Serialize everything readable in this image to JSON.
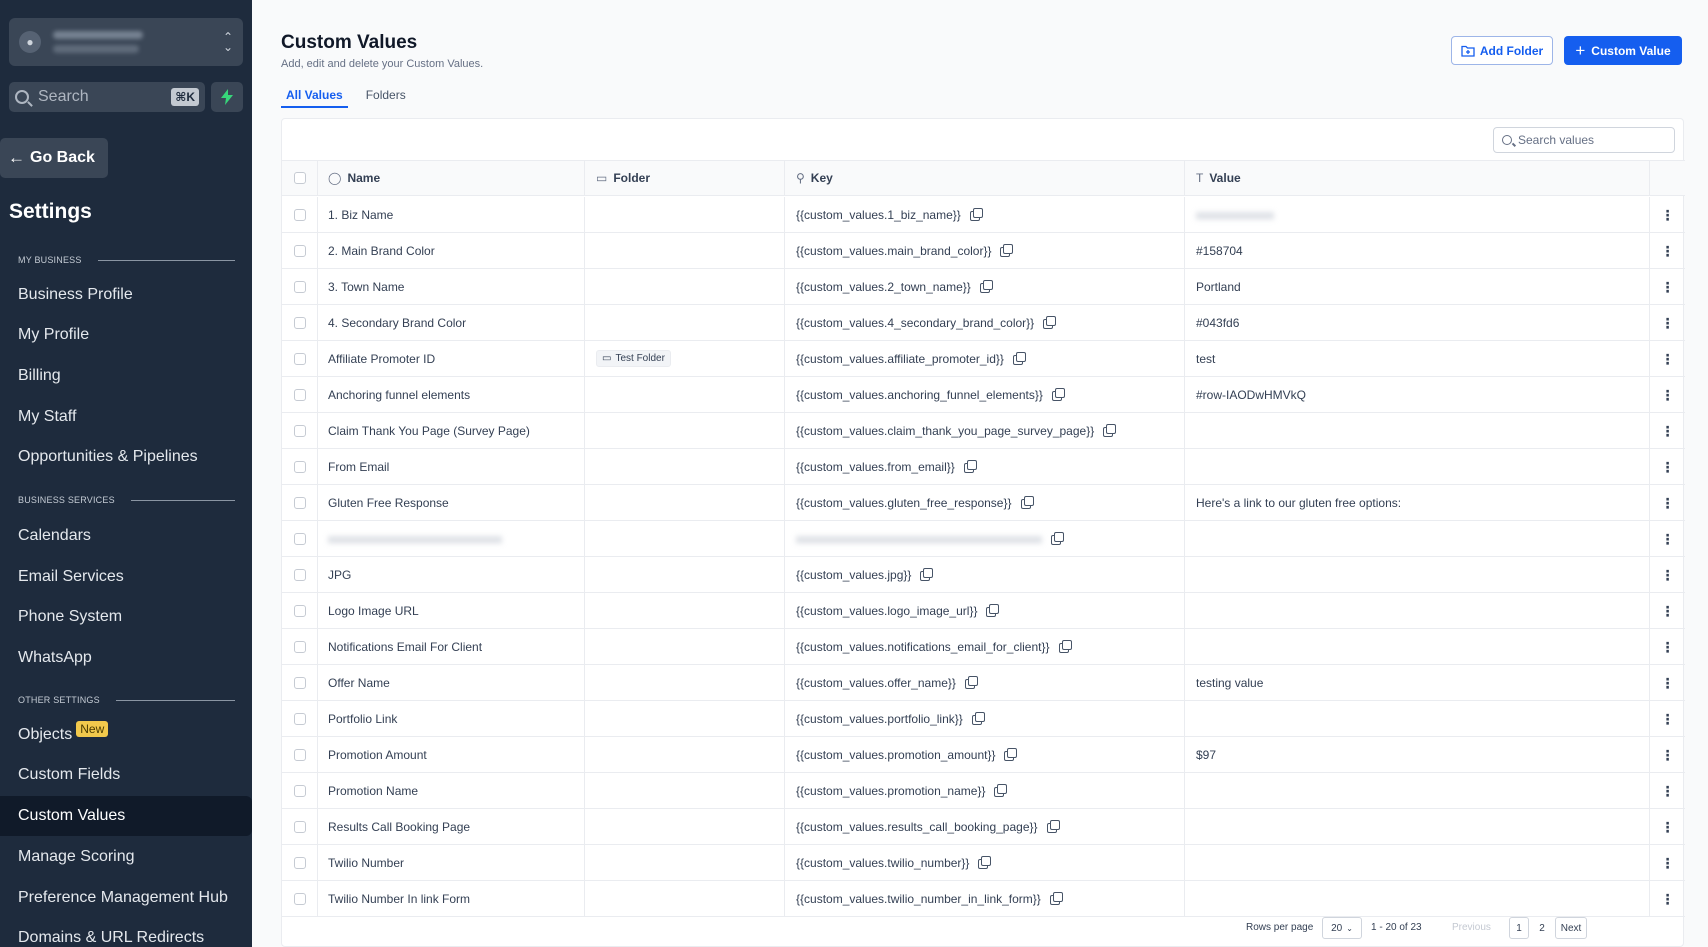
{
  "sidebar": {
    "search_placeholder": "Search",
    "shortcut": "⌘K",
    "go_back": "Go Back",
    "settings_title": "Settings",
    "sections": [
      {
        "label": "MY BUSINESS",
        "items": [
          "Business Profile",
          "My Profile",
          "Billing",
          "My Staff",
          "Opportunities & Pipelines"
        ]
      },
      {
        "label": "BUSINESS SERVICES",
        "items": [
          "Calendars",
          "Email Services",
          "Phone System",
          "WhatsApp"
        ]
      },
      {
        "label": "OTHER SETTINGS",
        "items": [
          "Objects",
          "Custom Fields",
          "Custom Values",
          "Manage Scoring",
          "Preference Management Hub",
          "Domains & URL Redirects"
        ]
      }
    ],
    "new_badge": "New",
    "active_item": "Custom Values"
  },
  "header": {
    "title": "Custom Values",
    "subtitle": "Add, edit and delete your Custom Values.",
    "add_folder": "Add Folder",
    "custom_value": "Custom Value"
  },
  "tabs": [
    "All Values",
    "Folders"
  ],
  "table": {
    "search_placeholder": "Search values",
    "columns": [
      "Name",
      "Folder",
      "Key",
      "Value"
    ],
    "rows": [
      {
        "name": "1. Biz Name",
        "folder": "",
        "key": "{{custom_values.1_biz_name}}",
        "value": ""
      },
      {
        "name": "2. Main Brand Color",
        "folder": "",
        "key": "{{custom_values.main_brand_color}}",
        "value": "#158704"
      },
      {
        "name": "3. Town Name",
        "folder": "",
        "key": "{{custom_values.2_town_name}}",
        "value": "Portland"
      },
      {
        "name": "4. Secondary Brand Color",
        "folder": "",
        "key": "{{custom_values.4_secondary_brand_color}}",
        "value": "#043fd6"
      },
      {
        "name": "Affiliate Promoter ID",
        "folder": "Test Folder",
        "key": "{{custom_values.affiliate_promoter_id}}",
        "value": "test"
      },
      {
        "name": "Anchoring funnel elements",
        "folder": "",
        "key": "{{custom_values.anchoring_funnel_elements}}",
        "value": "#row-IAODwHMVkQ"
      },
      {
        "name": "Claim Thank You Page (Survey Page)",
        "folder": "",
        "key": "{{custom_values.claim_thank_you_page_survey_page}}",
        "value": ""
      },
      {
        "name": "From Email",
        "folder": "",
        "key": "{{custom_values.from_email}}",
        "value": ""
      },
      {
        "name": "Gluten Free Response",
        "folder": "",
        "key": "{{custom_values.gluten_free_response}}",
        "value": "Here's a link to our gluten free options:"
      },
      {
        "name": "",
        "folder": "",
        "key": "",
        "value": ""
      },
      {
        "name": "JPG",
        "folder": "",
        "key": "{{custom_values.jpg}}",
        "value": ""
      },
      {
        "name": "Logo Image URL",
        "folder": "",
        "key": "{{custom_values.logo_image_url}}",
        "value": ""
      },
      {
        "name": "Notifications Email For Client",
        "folder": "",
        "key": "{{custom_values.notifications_email_for_client}}",
        "value": ""
      },
      {
        "name": "Offer Name",
        "folder": "",
        "key": "{{custom_values.offer_name}}",
        "value": "testing value"
      },
      {
        "name": "Portfolio Link",
        "folder": "",
        "key": "{{custom_values.portfolio_link}}",
        "value": ""
      },
      {
        "name": "Promotion Amount",
        "folder": "",
        "key": "{{custom_values.promotion_amount}}",
        "value": "$97"
      },
      {
        "name": "Promotion Name",
        "folder": "",
        "key": "{{custom_values.promotion_name}}",
        "value": ""
      },
      {
        "name": "Results Call Booking Page",
        "folder": "",
        "key": "{{custom_values.results_call_booking_page}}",
        "value": ""
      },
      {
        "name": "Twilio Number",
        "folder": "",
        "key": "{{custom_values.twilio_number}}",
        "value": ""
      },
      {
        "name": "Twilio Number In link Form",
        "folder": "",
        "key": "{{custom_values.twilio_number_in_link_form}}",
        "value": ""
      }
    ]
  },
  "pagination": {
    "rows_per_page_label": "Rows per page",
    "rows_per_page": "20",
    "range": "1 - 20 of 23",
    "previous": "Previous",
    "pages": [
      "1",
      "2"
    ],
    "next": "Next"
  },
  "colors": {
    "sidebar_bg": "#1e2b3d",
    "accent": "#155eef"
  }
}
